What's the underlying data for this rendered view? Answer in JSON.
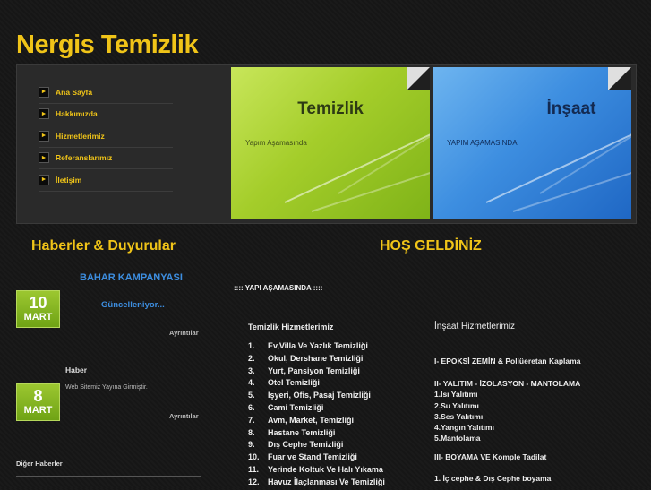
{
  "site": {
    "title": "Nergis Temizlik"
  },
  "menu": {
    "items": [
      {
        "label": "Ana Sayfa"
      },
      {
        "label": "Hakkımızda"
      },
      {
        "label": "Hizmetlerimiz"
      },
      {
        "label": "Referanslarımız"
      },
      {
        "label": "İletişim"
      }
    ]
  },
  "panels": {
    "cleaning": {
      "title": "Temizlik",
      "subtitle": "Yapım Aşamasında"
    },
    "construction": {
      "title": "İnşaat",
      "subtitle": "YAPIM AŞAMASINDA"
    }
  },
  "news": {
    "heading": "Haberler & Duyurular",
    "items": [
      {
        "title": "BAHAR KAMPANYASI",
        "day": "10",
        "month": "MART",
        "text": "Güncelleniyor...",
        "details": "Ayrıntılar"
      },
      {
        "title": "Haber",
        "day": "8",
        "month": "MART",
        "text": "Web Sitemiz Yayına Girmiştir.",
        "details": "Ayrıntılar"
      }
    ],
    "other_label": "Diğer Haberler"
  },
  "welcome": {
    "heading": "HOŞ GELDİNİZ",
    "notice": ":::: YAPI AŞAMASINDA ::::",
    "cleaning_heading": "Temizlik Hizmetlerimiz",
    "cleaning_services": [
      {
        "num": "1.",
        "label": "Ev,Villa Ve Yazlık Temizliği"
      },
      {
        "num": "2.",
        "label": "Okul, Dershane Temizliği"
      },
      {
        "num": "3.",
        "label": "Yurt, Pansiyon Temizliği"
      },
      {
        "num": "4.",
        "label": "Otel Temizliği"
      },
      {
        "num": "5.",
        "label": "İşyeri, Ofis, Pasaj Temizliği"
      },
      {
        "num": "6.",
        "label": "Cami Temizliği"
      },
      {
        "num": "7.",
        "label": "Avm, Market, Temizliği"
      },
      {
        "num": "8.",
        "label": "Hastane Temizliği"
      },
      {
        "num": "9.",
        "label": "Dış Cephe Temizliği"
      },
      {
        "num": "10.",
        "label": "Fuar ve Stand Temizliği"
      },
      {
        "num": "11.",
        "label": "Yerinde Koltuk Ve Halı Yıkama"
      },
      {
        "num": "12.",
        "label": "Havuz İlaçlanması Ve Temizliği"
      }
    ],
    "construction_heading": "İnşaat Hizmetlerimiz",
    "construction_services": {
      "group1": "I- EPOKSİ ZEMİN & Poliüeretan Kaplama",
      "group2_title": "II- YALITIM - İZOLASYON - MANTOLAMA",
      "group2_items": [
        "1.Isı Yalıtımı",
        "2.Su Yalıtımı",
        "3.Ses Yalıtımı",
        "4.Yangın Yalıtımı",
        "5.Mantolama"
      ],
      "group3_title": "III- BOYAMA VE Komple Tadilat",
      "group3_items": [
        "1. İç cephe & Dış Cephe boyama"
      ]
    }
  },
  "colors": {
    "accent": "#f0c418",
    "link_blue": "#3d8ee0",
    "badge_green": "#7fb318",
    "background": "#161616"
  }
}
